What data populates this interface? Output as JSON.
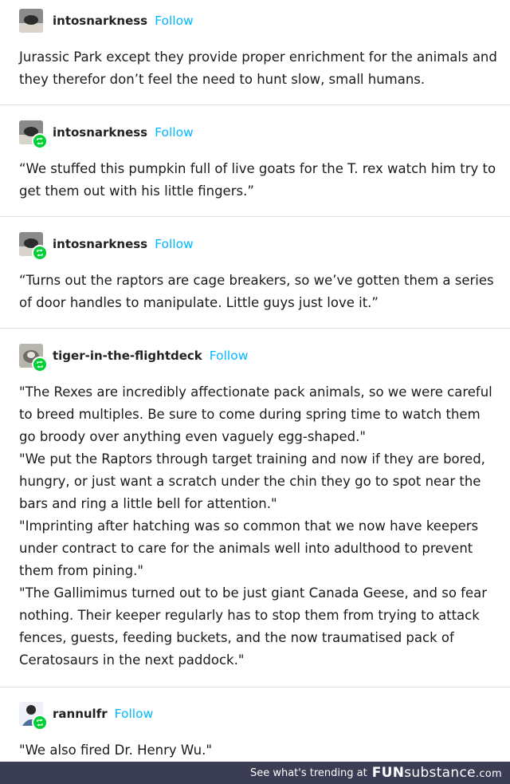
{
  "posts": [
    {
      "username": "intosnarkness",
      "follow_label": "Follow",
      "reblog": false,
      "paragraphs": [
        "Jurassic Park except they provide proper enrichment for the animals and they therefor don’t feel the need to hunt slow, small humans."
      ]
    },
    {
      "username": "intosnarkness",
      "follow_label": "Follow",
      "reblog": true,
      "paragraphs": [
        "“We stuffed this pumpkin full of live goats for the T. rex watch him try to get them out with his little fingers.”"
      ]
    },
    {
      "username": "intosnarkness",
      "follow_label": "Follow",
      "reblog": true,
      "paragraphs": [
        "“Turns out the raptors are cage breakers, so we’ve gotten them a series of door handles to manipulate. Little guys just love it.”"
      ]
    },
    {
      "username": "tiger-in-the-flightdeck",
      "follow_label": "Follow",
      "reblog": true,
      "paragraphs": [
        "\"The Rexes are incredibly affectionate pack animals, so we were careful to breed multiples. Be sure to come during spring time to watch them go broody over anything even vaguely egg-shaped.\"",
        "\"We put the Raptors through target training and now if they are bored, hungry, or just want a scratch under the chin they go to spot near the bars and ring a little bell for attention.\"",
        "\"Imprinting after hatching was so common that we now have keepers under contract to care for the animals well into adulthood to prevent them from pining.\"",
        "\"The Gallimimus turned out to be just giant Canada Geese, and so fear nothing. Their keeper regularly has to stop them from trying to attack fences, guests, feeding buckets, and the now traumatised pack of Ceratosaurs in the next paddock.\""
      ]
    },
    {
      "username": "rannulfr",
      "follow_label": "Follow",
      "reblog": true,
      "paragraphs": [
        "\"We also fired Dr. Henry Wu.\""
      ]
    }
  ],
  "footer": {
    "text": "See what's trending at",
    "logo_bold": "FUN",
    "logo_rest": "substance",
    "logo_suffix": ".com"
  },
  "colors": {
    "follow": "#00b8ff",
    "reblog_badge": "#00cf35",
    "footer_bg": "#3a3d54"
  }
}
